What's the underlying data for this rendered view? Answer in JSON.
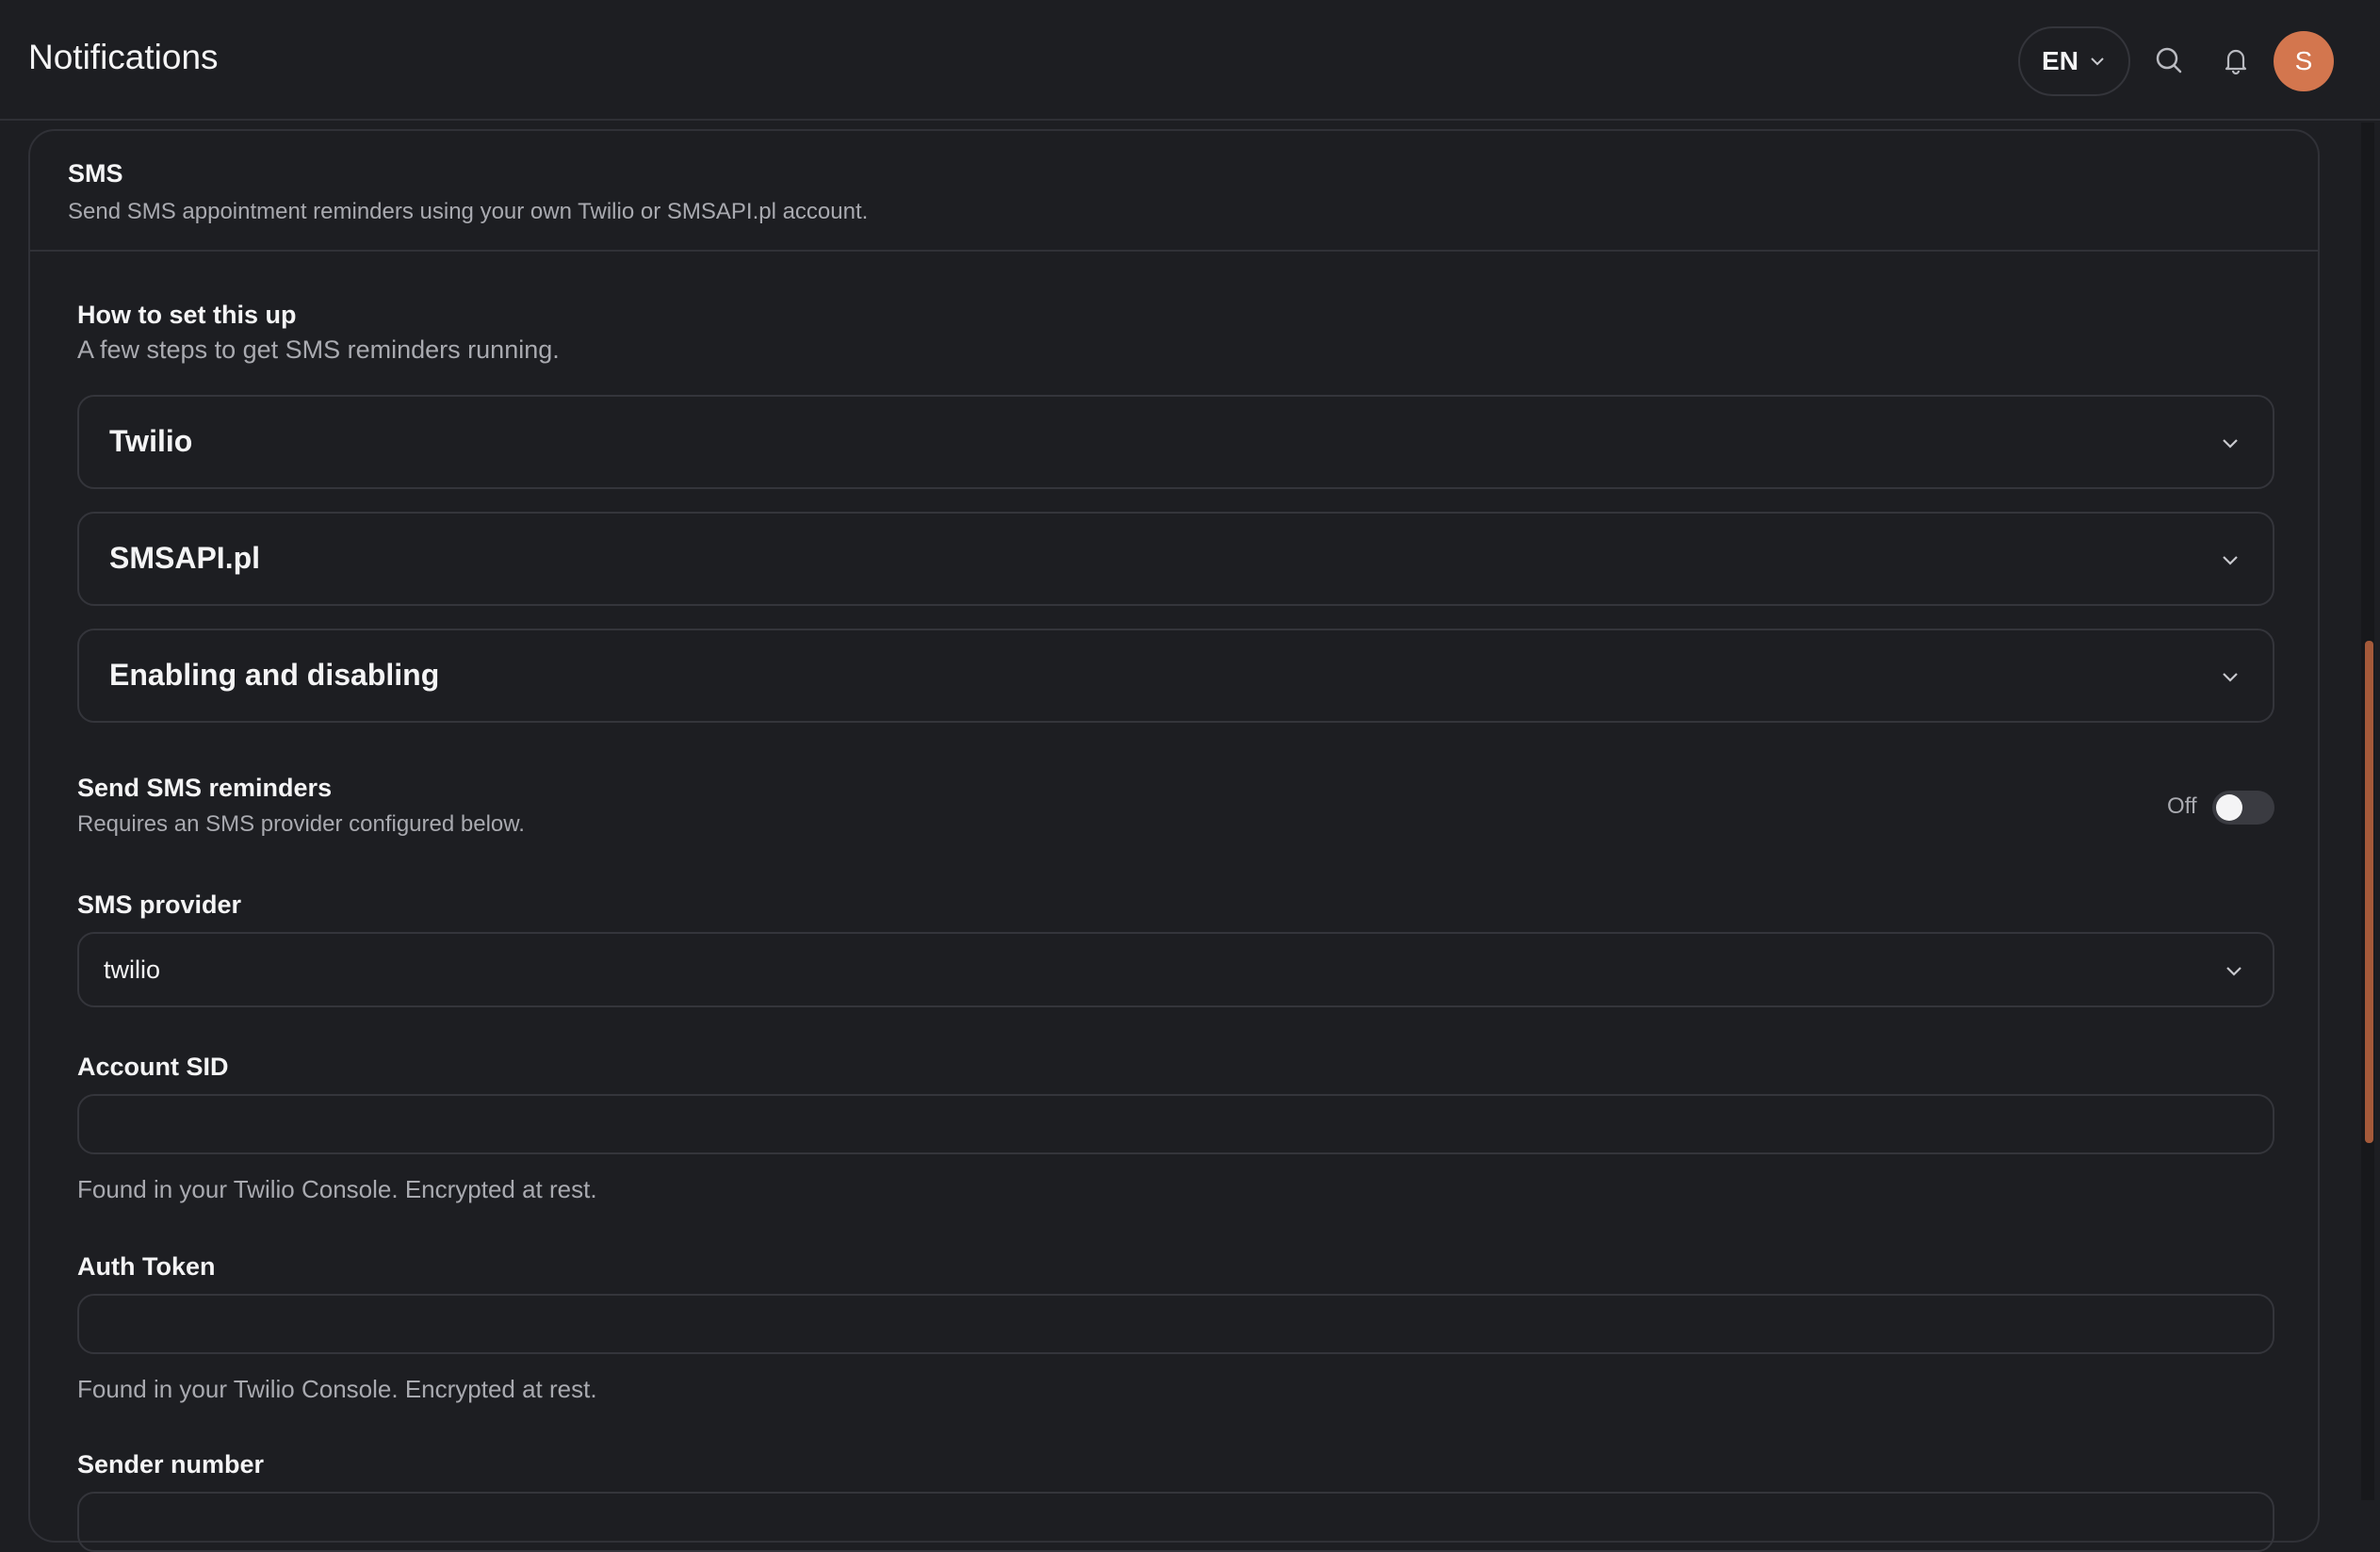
{
  "header": {
    "title": "Notifications",
    "language": "EN",
    "avatar_initial": "S",
    "icons": [
      "chevron-down-icon",
      "search-icon",
      "bell-icon"
    ]
  },
  "colors": {
    "background": "#1d1e22",
    "border": "#34353b",
    "accent": "#d3764e",
    "text_primary": "#f4f4f5",
    "text_muted": "#a9aab0"
  },
  "sms": {
    "title": "SMS",
    "description": "Send SMS appointment reminders using your own Twilio or SMSAPI.pl account.",
    "setup": {
      "title": "How to set this up",
      "subtitle": "A few steps to get SMS reminders running.",
      "sections": [
        "Twilio",
        "SMSAPI.pl",
        "Enabling and disabling"
      ]
    },
    "send_reminders": {
      "label": "Send SMS reminders",
      "hint": "Requires an SMS provider configured below.",
      "state_label": "Off",
      "enabled": false
    },
    "provider": {
      "label": "SMS provider",
      "value": "twilio"
    },
    "account_sid": {
      "label": "Account SID",
      "value": "",
      "hint": "Found in your Twilio Console. Encrypted at rest."
    },
    "auth_token": {
      "label": "Auth Token",
      "value": "",
      "hint": "Found in your Twilio Console. Encrypted at rest."
    },
    "sender_number": {
      "label": "Sender number"
    }
  }
}
